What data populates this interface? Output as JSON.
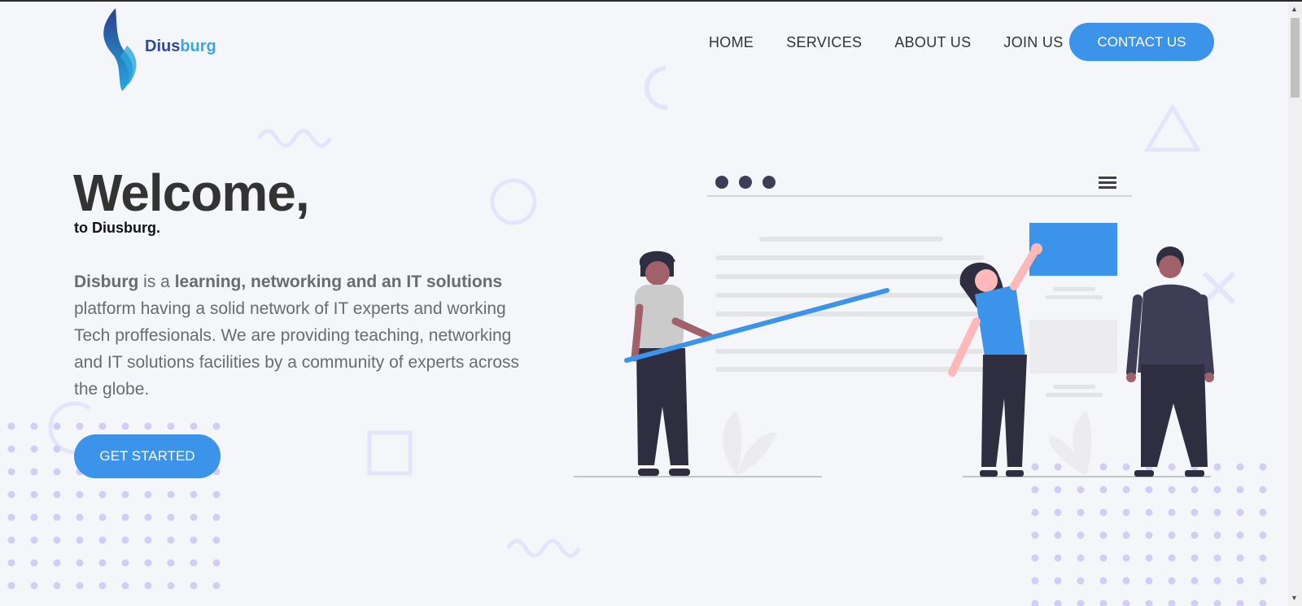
{
  "brand": {
    "name_part1": "Dius",
    "name_part2": "burg",
    "logo_icon": "flame-logo-icon"
  },
  "nav": {
    "items": [
      "HOME",
      "SERVICES",
      "ABOUT US",
      "JOIN US"
    ],
    "cta_label": "CONTACT US"
  },
  "hero": {
    "title": "Welcome,",
    "subtitle": "to Diusburg.",
    "desc_brand": "Disburg",
    "desc_text1": " is a ",
    "desc_bold": "learning, networking and an IT solutions",
    "desc_text2": " platform having a solid network of IT experts and working Tech proffesionals. We are providing teaching, networking and IT solutions facilities by a community of experts across the globe.",
    "button_label": "GET STARTED"
  },
  "colors": {
    "accent": "#3b93ea",
    "decor": "#e6e4fb",
    "dots": "#d3cdf6",
    "heading": "#333333"
  }
}
